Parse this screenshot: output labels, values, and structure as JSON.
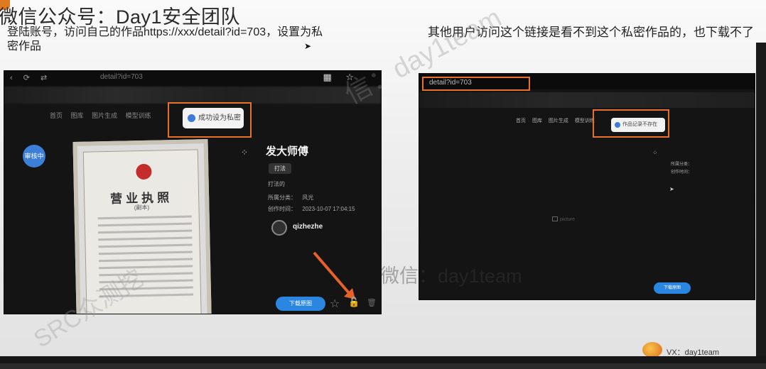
{
  "slide": {
    "title": "微信公众号：Day1安全团队",
    "caption_left": "登陆账号，访问自己的作品https://xxx/detail?id=703，设置为私密作品",
    "caption_right": "其他用户访问这个链接是看不到这个私密作品的，也下载不了",
    "watermark_center": "微信：day1team",
    "watermark_diag1": "信：day1team",
    "watermark_diag2": "SRC众测挖",
    "footer_vx": "VX：day1team"
  },
  "left_shot": {
    "url": "detail?id=703",
    "nav": [
      "首页",
      "图库",
      "图片生成",
      "模型训练"
    ],
    "toast": "成功设为私密",
    "review_badge": "审核中",
    "license": {
      "title": "营业执照",
      "subtitle": "(副本)"
    },
    "work_title": "发大师傅",
    "tag": "打法",
    "desc": "打法的",
    "category_label": "所属分类：",
    "category_value": "风光",
    "time_label": "创作时间：",
    "time_value": "2023-10-07 17:04:15",
    "username": "qizhezhe",
    "download_label": "下载原图"
  },
  "right_shot": {
    "url": "detail?id=703",
    "nav": [
      "首页",
      "图库",
      "图片生成",
      "模型训练"
    ],
    "toast": "作品记录不存在",
    "category_label": "所属分类：",
    "time_label": "创作时间：",
    "broken_image_alt": "picture",
    "download_label": "下载原图"
  },
  "colors": {
    "highlight": "#e8702a",
    "primary": "#2a86e0",
    "background": "#141414"
  }
}
